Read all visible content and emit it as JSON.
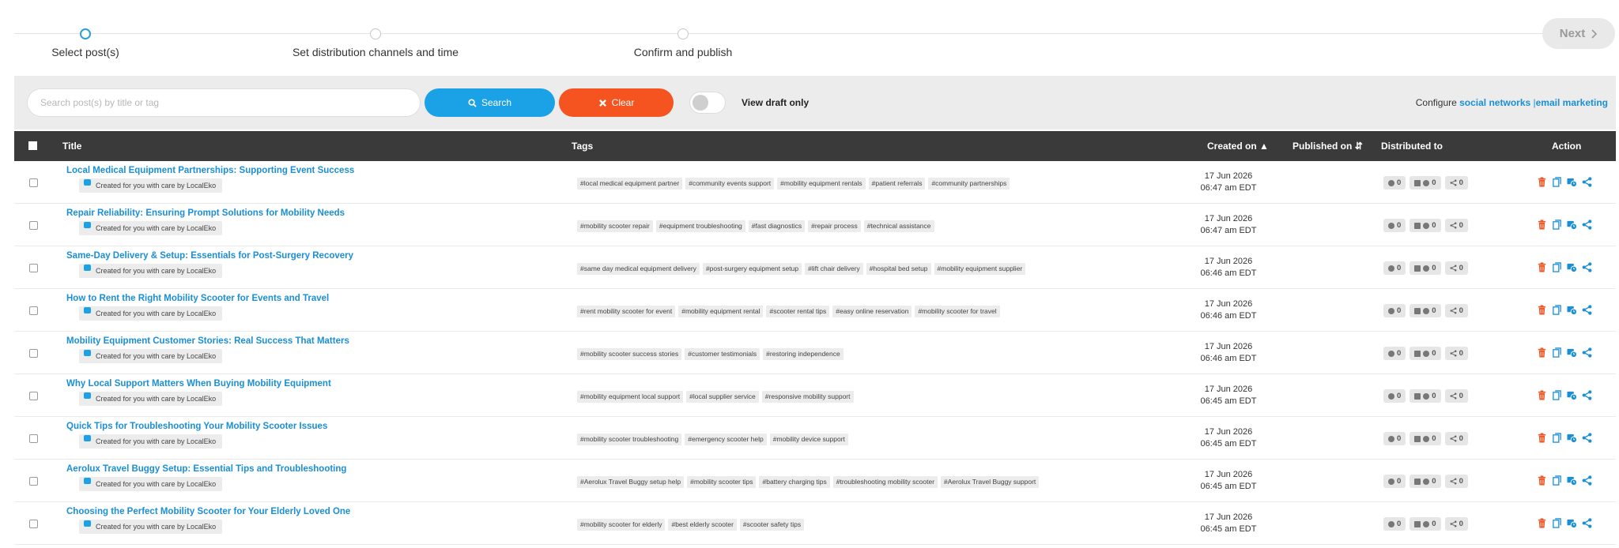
{
  "stepper": {
    "steps": [
      {
        "label": "Select post(s)"
      },
      {
        "label": "Set distribution channels and time"
      },
      {
        "label": "Confirm and publish"
      }
    ],
    "next_label": "Next"
  },
  "filter": {
    "search_placeholder": "Search post(s) by title or tag",
    "search_label": "Search",
    "clear_label": "Clear",
    "toggle_label": "View draft only",
    "configure_prefix": "Configure ",
    "social_link": "social networks",
    "separator": " |",
    "email_link": "email marketing"
  },
  "table": {
    "headers": {
      "title": "Title",
      "tags": "Tags",
      "created": "Created on",
      "published": "Published on",
      "distributed": "Distributed to",
      "action": "Action"
    },
    "badge_text": "Created for you with care by LocalEko",
    "rows": [
      {
        "title": "Local Medical Equipment Partnerships: Supporting Event Success",
        "tags": [
          "#local medical equipment partner",
          "#community events support",
          "#mobility equipment rentals",
          "#patient referrals",
          "#community partnerships"
        ],
        "date": "17 Jun 2026",
        "time": "06:47 am EDT",
        "d1": "0",
        "d2": "0",
        "d3": "0"
      },
      {
        "title": "Repair Reliability: Ensuring Prompt Solutions for Mobility Needs",
        "tags": [
          "#mobility scooter repair",
          "#equipment troubleshooting",
          "#fast diagnostics",
          "#repair process",
          "#technical assistance"
        ],
        "date": "17 Jun 2026",
        "time": "06:47 am EDT",
        "d1": "0",
        "d2": "0",
        "d3": "0"
      },
      {
        "title": "Same-Day Delivery & Setup: Essentials for Post-Surgery Recovery",
        "tags": [
          "#same day medical equipment delivery",
          "#post-surgery equipment setup",
          "#lift chair delivery",
          "#hospital bed setup",
          "#mobility equipment supplier"
        ],
        "date": "17 Jun 2026",
        "time": "06:46 am EDT",
        "d1": "0",
        "d2": "0",
        "d3": "0"
      },
      {
        "title": "How to Rent the Right Mobility Scooter for Events and Travel",
        "tags": [
          "#rent mobility scooter for event",
          "#mobility equipment rental",
          "#scooter rental tips",
          "#easy online reservation",
          "#mobility scooter for travel"
        ],
        "date": "17 Jun 2026",
        "time": "06:46 am EDT",
        "d1": "0",
        "d2": "0",
        "d3": "0"
      },
      {
        "title": "Mobility Equipment Customer Stories: Real Success That Matters",
        "tags": [
          "#mobility scooter success stories",
          "#customer testimonials",
          "#restoring independence"
        ],
        "date": "17 Jun 2026",
        "time": "06:46 am EDT",
        "d1": "0",
        "d2": "0",
        "d3": "0"
      },
      {
        "title": "Why Local Support Matters When Buying Mobility Equipment",
        "tags": [
          "#mobility equipment local support",
          "#local supplier service",
          "#responsive mobility support"
        ],
        "date": "17 Jun 2026",
        "time": "06:45 am EDT",
        "d1": "0",
        "d2": "0",
        "d3": "0"
      },
      {
        "title": "Quick Tips for Troubleshooting Your Mobility Scooter Issues",
        "tags": [
          "#mobility scooter troubleshooting",
          "#emergency scooter help",
          "#mobility device support"
        ],
        "date": "17 Jun 2026",
        "time": "06:45 am EDT",
        "d1": "0",
        "d2": "0",
        "d3": "0"
      },
      {
        "title": "Aerolux Travel Buggy Setup: Essential Tips and Troubleshooting",
        "tags": [
          "#Aerolux Travel Buggy setup help",
          "#mobility scooter tips",
          "#battery charging tips",
          "#troubleshooting mobility scooter",
          "#Aerolux Travel Buggy support"
        ],
        "date": "17 Jun 2026",
        "time": "06:45 am EDT",
        "d1": "0",
        "d2": "0",
        "d3": "0"
      },
      {
        "title": "Choosing the Perfect Mobility Scooter for Your Elderly Loved One",
        "tags": [
          "#mobility scooter for elderly",
          "#best elderly scooter",
          "#scooter safety tips"
        ],
        "date": "17 Jun 2026",
        "time": "06:45 am EDT",
        "d1": "0",
        "d2": "0",
        "d3": "0"
      }
    ]
  },
  "colors": {
    "accent": "#1aa1e6",
    "clear": "#f5531f",
    "delete": "#f05323",
    "header": "#3a3a3a"
  }
}
